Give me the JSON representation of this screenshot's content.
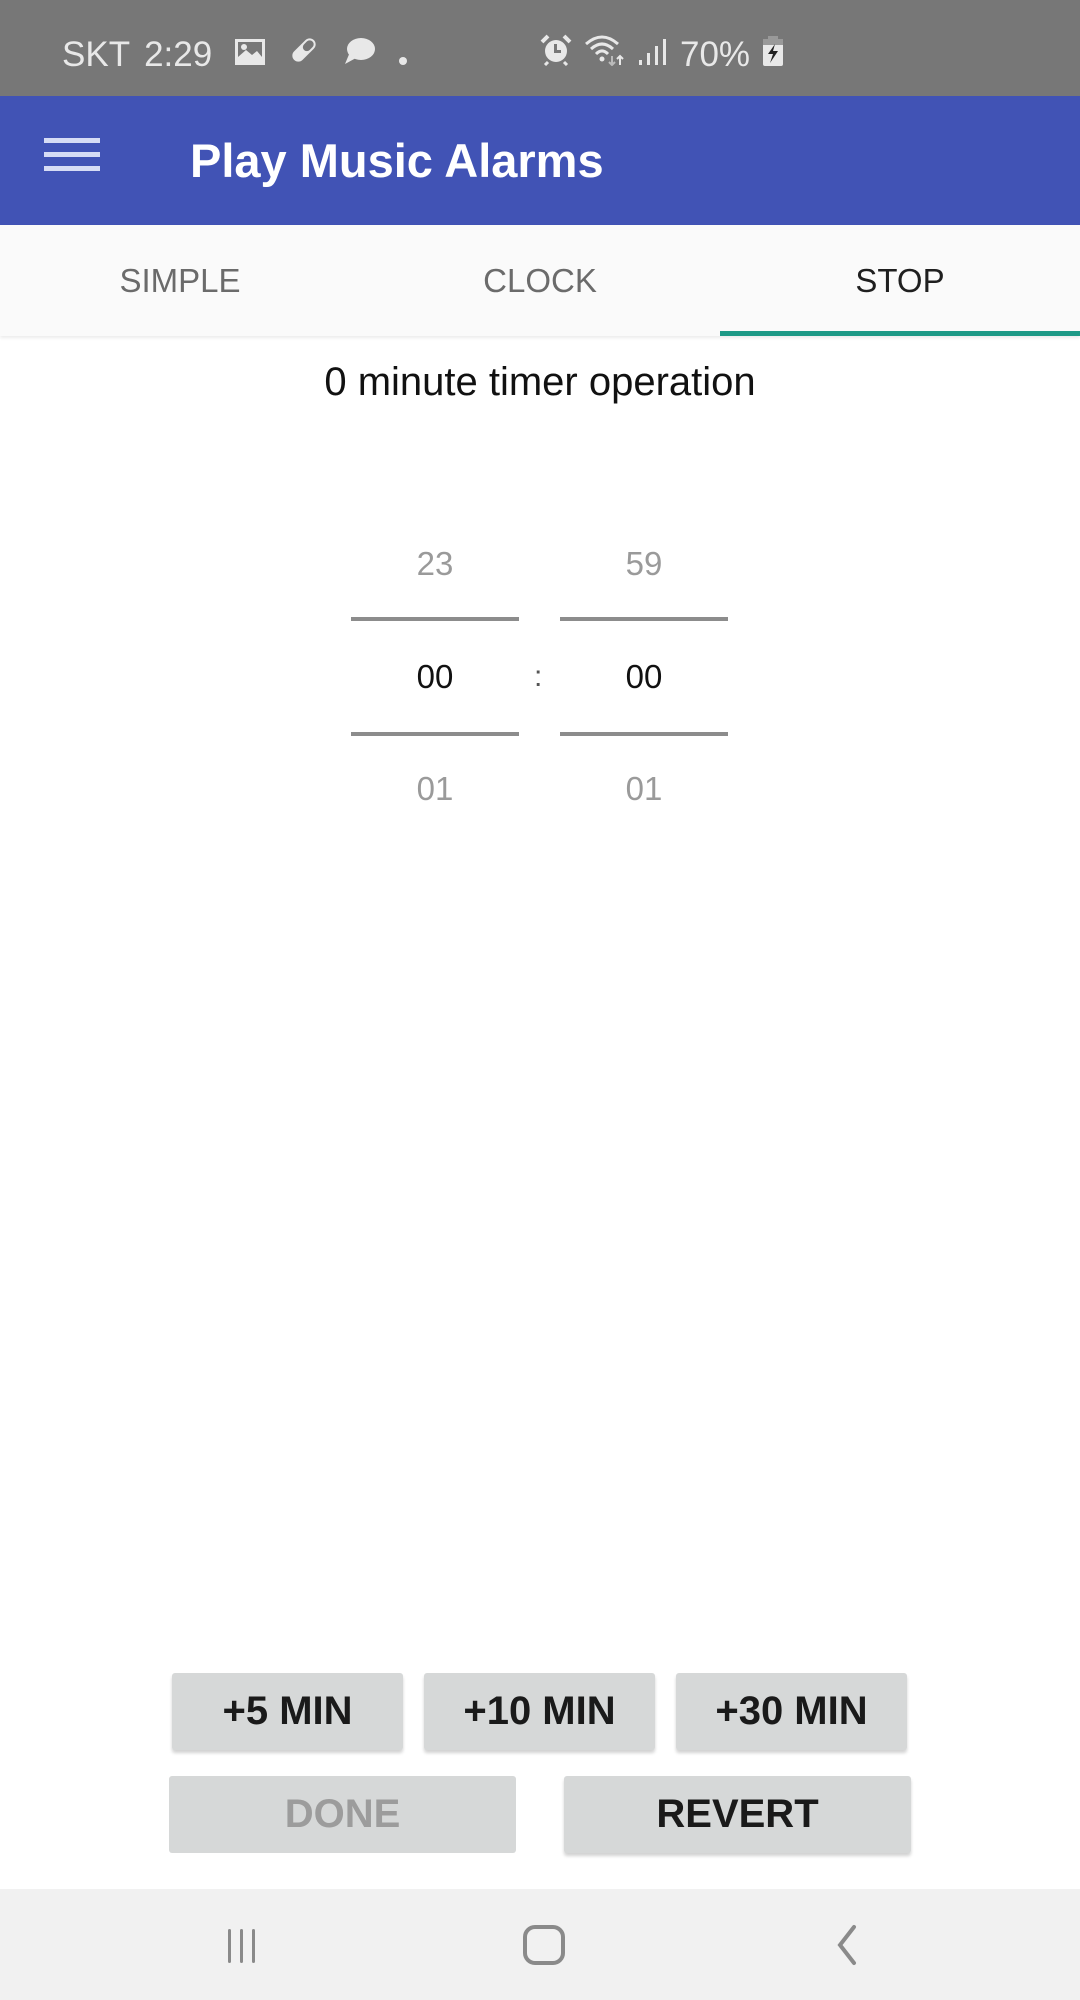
{
  "status_bar": {
    "carrier": "SKT",
    "time": "2:29",
    "battery_percent": "70%",
    "left_icons": [
      "image-icon",
      "pill-icon",
      "chat-bubble-icon",
      "dot-icon"
    ],
    "right_icons": [
      "alarm-icon",
      "wifi-icon",
      "signal-icon",
      "battery-charging-icon"
    ]
  },
  "app_bar": {
    "title": "Play Music Alarms",
    "menu_icon": "hamburger-menu-icon",
    "color": "#4153b5"
  },
  "tabs": {
    "items": [
      {
        "label": "SIMPLE",
        "active": false
      },
      {
        "label": "CLOCK",
        "active": false
      },
      {
        "label": "STOP",
        "active": true
      }
    ],
    "indicator_color": "#1e9a87"
  },
  "main": {
    "heading": "0 minute timer operation",
    "picker": {
      "hours": {
        "prev": "23",
        "current": "00",
        "next": "01"
      },
      "separator": ":",
      "minutes": {
        "prev": "59",
        "current": "00",
        "next": "01"
      }
    }
  },
  "buttons": {
    "plus5": "+5 MIN",
    "plus10": "+10 MIN",
    "plus30": "+30 MIN",
    "done": "DONE",
    "revert": "REVERT"
  },
  "nav_bar": {
    "recents": "recents-icon",
    "home": "home-icon",
    "back": "back-icon"
  }
}
